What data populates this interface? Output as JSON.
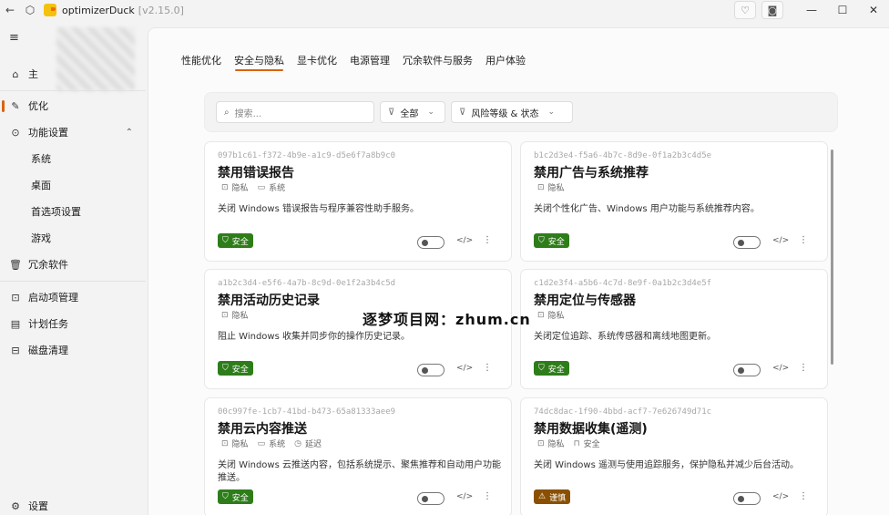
{
  "titlebar": {
    "app_name": "optimizerDuck",
    "version": "[v2.15.0]",
    "back_icon": "←",
    "home_icon": "⬡",
    "heart_icon": "♡",
    "camera_icon": "◙",
    "minimize": "—",
    "maximize": "☐",
    "close": "✕"
  },
  "sidebar": {
    "menu_icon": "≡",
    "home_label": "主",
    "items": [
      {
        "label": "优化",
        "icon": "✎"
      },
      {
        "label": "功能设置",
        "icon": "⊙",
        "chevron": "⌃"
      },
      {
        "label": "系统"
      },
      {
        "label": "桌面"
      },
      {
        "label": "首选项设置"
      },
      {
        "label": "游戏"
      },
      {
        "label": "冗余软件",
        "icon": "🗑"
      },
      {
        "label": "启动项管理",
        "icon": "⊡"
      },
      {
        "label": "计划任务",
        "icon": "▤"
      },
      {
        "label": "磁盘清理",
        "icon": "⊟"
      }
    ],
    "settings_label": "设置",
    "settings_icon": "⚙"
  },
  "tabs": [
    {
      "label": "性能优化"
    },
    {
      "label": "安全与隐私",
      "active": true
    },
    {
      "label": "显卡优化"
    },
    {
      "label": "电源管理"
    },
    {
      "label": "冗余软件与服务"
    },
    {
      "label": "用户体验"
    }
  ],
  "toolbar": {
    "search_placeholder": "搜索...",
    "filter_all": "全部",
    "filter_risk": "风险等级 & 状态"
  },
  "cards": [
    {
      "uuid": "097b1c61-f372-4b9e-a1c9-d5e6f7a8b9c0",
      "title": "禁用错误报告",
      "tags": [
        {
          "label": "隐私",
          "icon": "⊡"
        },
        {
          "label": "系统",
          "icon": "▭"
        }
      ],
      "desc": "关闭 Windows 错误报告与程序兼容性助手服务。",
      "badge": "安全",
      "badge_type": "safe"
    },
    {
      "uuid": "b1c2d3e4-f5a6-4b7c-8d9e-0f1a2b3c4d5e",
      "title": "禁用广告与系统推荐",
      "tags": [
        {
          "label": "隐私",
          "icon": "⊡"
        }
      ],
      "desc": "关闭个性化广告、Windows 用户功能与系统推荐内容。",
      "badge": "安全",
      "badge_type": "safe"
    },
    {
      "uuid": "a1b2c3d4-e5f6-4a7b-8c9d-0e1f2a3b4c5d",
      "title": "禁用活动历史记录",
      "tags": [
        {
          "label": "隐私",
          "icon": "⊡"
        }
      ],
      "desc": "阻止 Windows 收集并同步你的操作历史记录。",
      "badge": "安全",
      "badge_type": "safe"
    },
    {
      "uuid": "c1d2e3f4-a5b6-4c7d-8e9f-0a1b2c3d4e5f",
      "title": "禁用定位与传感器",
      "tags": [
        {
          "label": "隐私",
          "icon": "⊡"
        }
      ],
      "desc": "关闭定位追踪、系统传感器和离线地图更新。",
      "badge": "安全",
      "badge_type": "safe"
    },
    {
      "uuid": "00c997fe-1cb7-41bd-b473-65a81333aee9",
      "title": "禁用云内容推送",
      "tags": [
        {
          "label": "隐私",
          "icon": "⊡"
        },
        {
          "label": "系统",
          "icon": "▭"
        },
        {
          "label": "延迟",
          "icon": "◷"
        }
      ],
      "desc": "关闭 Windows 云推送内容，包括系统提示、聚焦推荐和自动用户功能推送。",
      "badge": "安全",
      "badge_type": "safe"
    },
    {
      "uuid": "74dc8dac-1f90-4bbd-acf7-7e626749d71c",
      "title": "禁用数据收集(遥测)",
      "tags": [
        {
          "label": "隐私",
          "icon": "⊡"
        },
        {
          "label": "安全",
          "icon": "⊓"
        }
      ],
      "desc": "关闭 Windows 遥测与使用追踪服务，保护隐私并减少后台活动。",
      "badge": "谨慎",
      "badge_type": "caution"
    }
  ],
  "card_icons": {
    "safe_icon": "⛉",
    "caution_icon": "⚠",
    "code_icon": "</>",
    "more_icon": "⋮"
  },
  "watermark": "逐梦项目网：zhum.cn"
}
